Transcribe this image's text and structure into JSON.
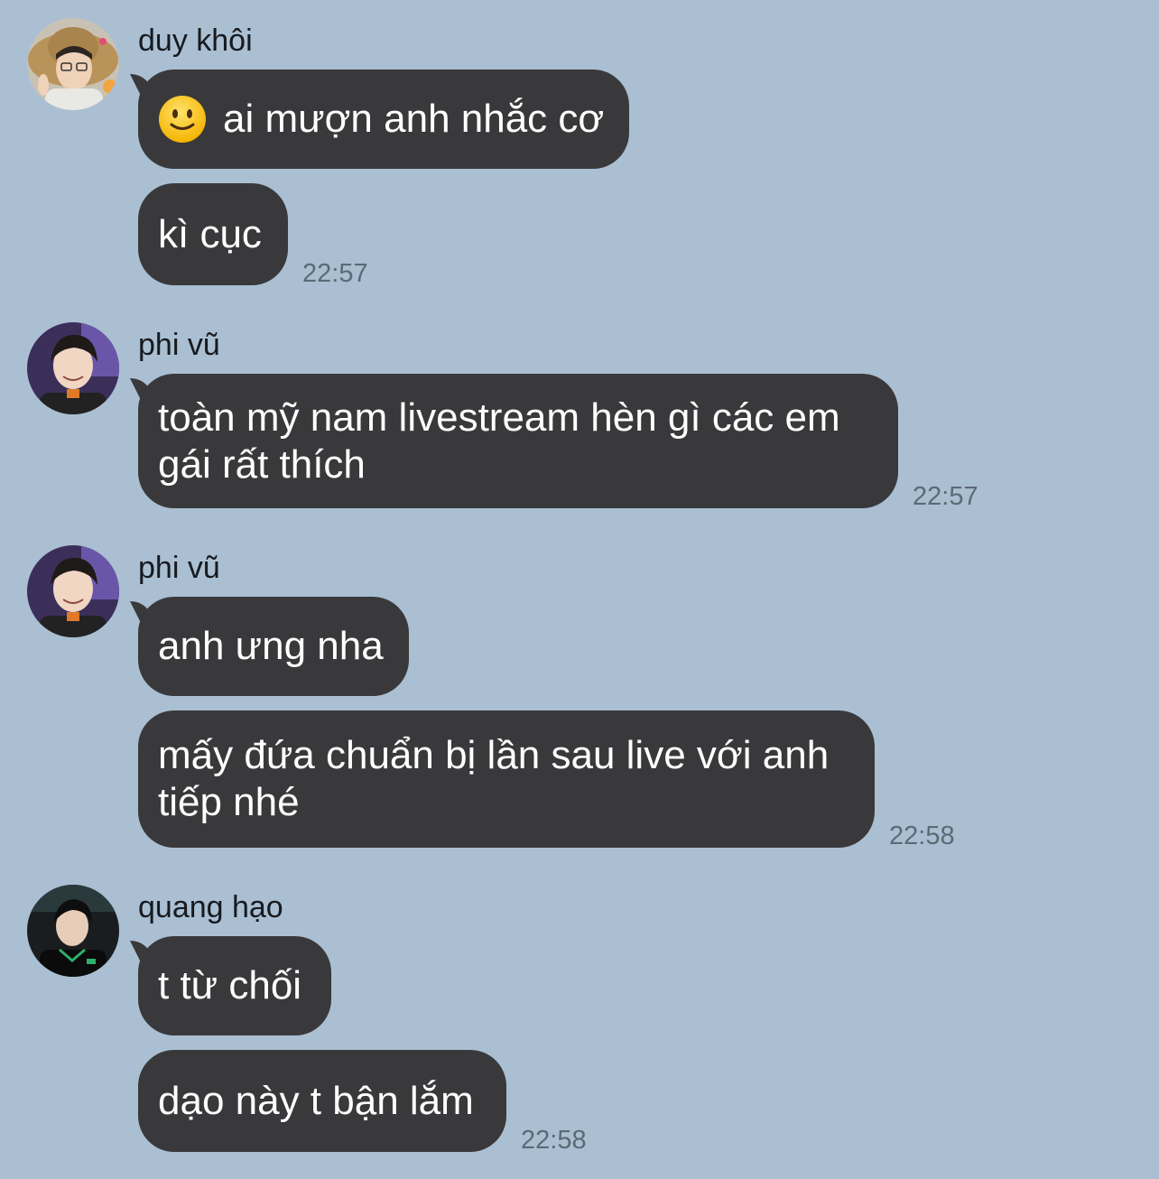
{
  "messages": [
    {
      "sender": "duy khôi",
      "avatar_icon": "avatar-duy-khoi",
      "bubbles": [
        {
          "emoji": "slightly-smiling-face-icon",
          "text": "ai mượn anh nhắc cơ"
        },
        {
          "text": "kì cục"
        }
      ],
      "time": "22:57"
    },
    {
      "sender": "phi vũ",
      "avatar_icon": "avatar-phi-vu",
      "bubbles": [
        {
          "text": "toàn mỹ nam livestream hèn gì các em gái rất thích"
        }
      ],
      "time": "22:57"
    },
    {
      "sender": "phi vũ",
      "avatar_icon": "avatar-phi-vu",
      "bubbles": [
        {
          "text": "anh ưng nha"
        },
        {
          "text": "mấy đứa chuẩn bị lần sau live với anh tiếp nhé"
        }
      ],
      "time": "22:58"
    },
    {
      "sender": "quang hạo",
      "avatar_icon": "avatar-quang-hao",
      "bubbles": [
        {
          "text": "t từ chối"
        },
        {
          "text": "dạo này t bận lắm"
        }
      ],
      "time": "22:58"
    }
  ],
  "colors": {
    "background": "#aabfd2",
    "bubble": "#39393b",
    "bubble_text": "#ffffff",
    "timestamp": "#5c6a76"
  }
}
